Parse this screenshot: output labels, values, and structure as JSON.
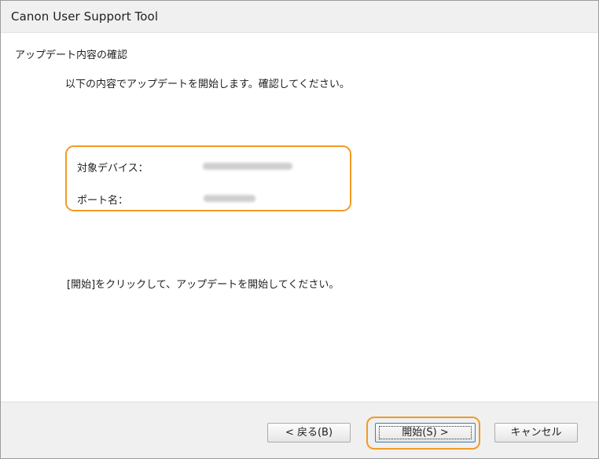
{
  "window": {
    "title": "Canon User Support Tool"
  },
  "page": {
    "header_title": "アップデート内容の確認",
    "instruction": "以下の内容でアップデートを開始します。確認してください。",
    "device_label": "対象デバイス：",
    "port_label": "ポート名：",
    "click_instruction": "[開始]をクリックして、アップデートを開始してください。"
  },
  "buttons": {
    "back_label": "< 戻る(B)",
    "start_label": "開始(S) >",
    "cancel_label": "キャンセル"
  },
  "colors": {
    "highlight": "#f29b21",
    "footer_bg": "#f0f0f0"
  }
}
